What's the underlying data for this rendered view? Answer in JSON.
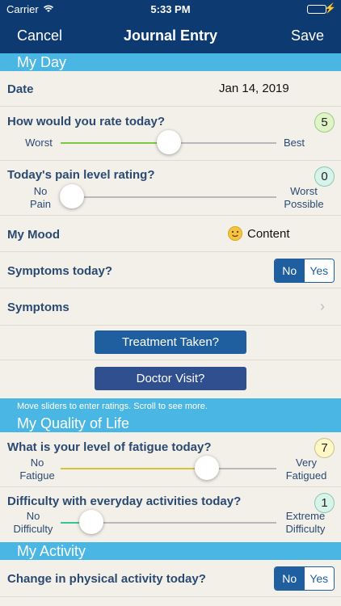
{
  "status": {
    "carrier": "Carrier",
    "time": "5:33 PM"
  },
  "nav": {
    "cancel": "Cancel",
    "title": "Journal Entry",
    "save": "Save"
  },
  "sections": {
    "my_day": "My Day",
    "quality": "My Quality of Life",
    "activity": "My Activity"
  },
  "date": {
    "label": "Date",
    "value": "Jan 14, 2019"
  },
  "rate_today": {
    "label": "How would you rate today?",
    "value": "5",
    "min": "Worst",
    "max": "Best",
    "level": 0.5
  },
  "pain": {
    "label": "Today's pain level rating?",
    "value": "0",
    "min_line1": "No",
    "min_line2": "Pain",
    "max_line1": "Worst",
    "max_line2": "Possible",
    "level": 0.0
  },
  "mood": {
    "label": "My Mood",
    "value": "Content",
    "icon": "smiley-face-icon"
  },
  "symptoms_today": {
    "label": "Symptoms today?",
    "no": "No",
    "yes": "Yes",
    "selected": "No"
  },
  "symptoms": {
    "label": "Symptoms"
  },
  "buttons": {
    "treatment": "Treatment Taken?",
    "doctor": "Doctor Visit?"
  },
  "hint": "Move sliders to enter ratings. Scroll to see more.",
  "fatigue": {
    "label": "What is your level of fatigue today?",
    "value": "7",
    "min_line1": "No",
    "min_line2": "Fatigue",
    "max_line1": "Very",
    "max_line2": "Fatigued",
    "level": 0.7
  },
  "difficulty": {
    "label": "Difficulty with everyday activities today?",
    "value": "1",
    "min_line1": "No",
    "min_line2": "Difficulty",
    "max_line1": "Extreme",
    "max_line2": "Difficulty",
    "level": 0.1
  },
  "physical": {
    "label": "Change in physical activity today?",
    "no": "No",
    "yes": "Yes",
    "selected": "No"
  },
  "colors": {
    "nav_bg": "#0e3a72",
    "section_bg": "#4ab6e3",
    "label": "#2a4a72",
    "btn_treatment": "#1f5f9f",
    "btn_doctor": "#2f4f8f",
    "fill_rate": "#7ac943",
    "fill_fatigue": "#d8c13a",
    "fill_difficulty": "#3bc29a"
  }
}
